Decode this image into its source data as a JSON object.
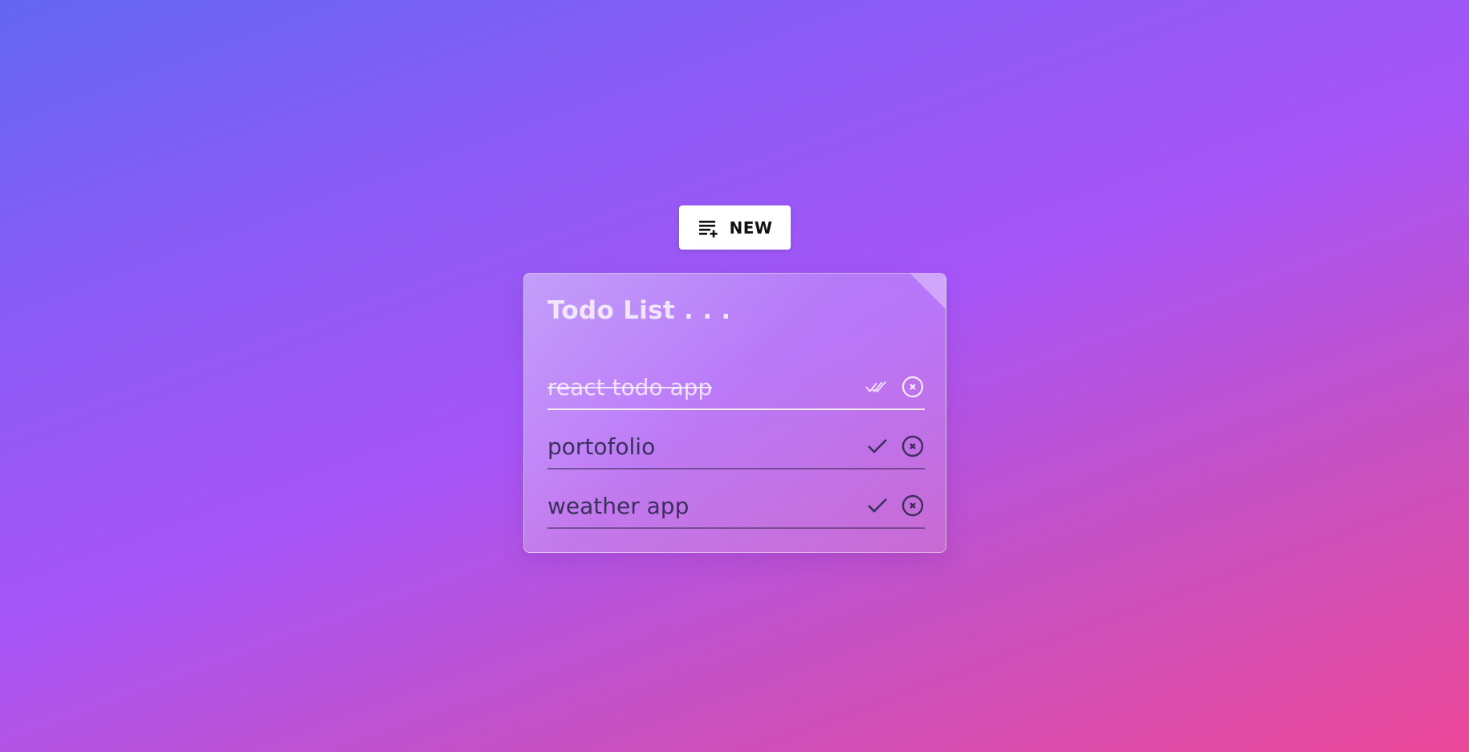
{
  "new_button": {
    "label": "NEW",
    "icon": "playlist-add-icon"
  },
  "todo_list": {
    "title": "Todo List . . .",
    "items": [
      {
        "text": "react todo app",
        "done": true,
        "complete_icon": "double-check-icon",
        "delete_icon": "close-circle-icon"
      },
      {
        "text": "portofolio",
        "done": false,
        "complete_icon": "check-icon",
        "delete_icon": "close-circle-icon"
      },
      {
        "text": "weather app",
        "done": false,
        "complete_icon": "check-icon",
        "delete_icon": "close-circle-icon"
      }
    ]
  },
  "colors": {
    "gradient_start": "#6366f1",
    "gradient_mid": "#a855f7",
    "gradient_end": "#ec4899",
    "item_text": "#3b2f5c",
    "done_text": "#ffffff"
  }
}
